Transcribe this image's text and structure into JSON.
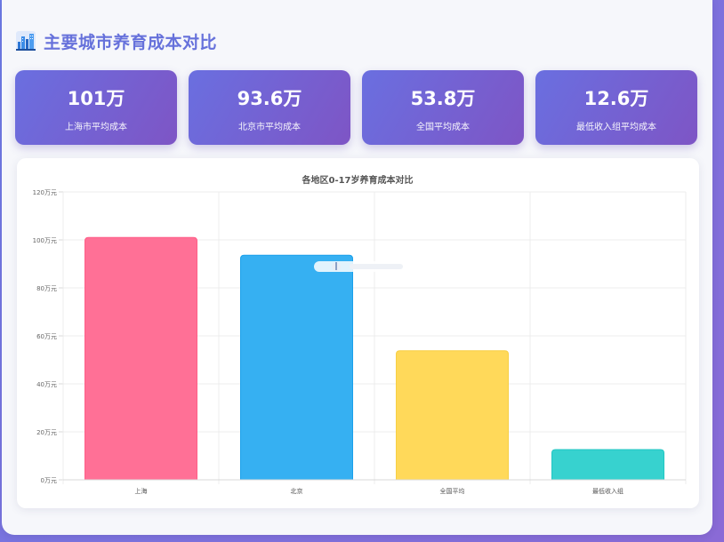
{
  "page": {
    "title": "主要城市养育成本对比",
    "icon": "city-chart-icon"
  },
  "stats": [
    {
      "value": "101万",
      "label": "上海市平均成本"
    },
    {
      "value": "93.6万",
      "label": "北京市平均成本"
    },
    {
      "value": "53.8万",
      "label": "全国平均成本"
    },
    {
      "value": "12.6万",
      "label": "最低收入组平均成本"
    }
  ],
  "colors": {
    "title": "#6671db",
    "card_gradient_start": "#6a6fe0",
    "card_gradient_end": "#7e55c5",
    "bars": [
      "#ff7096",
      "#36b0f2",
      "#ffd95a",
      "#37d2cf"
    ],
    "bar_borders": [
      "#ff5f88",
      "#1aa0eb",
      "#f7cf45",
      "#22c6c3"
    ]
  },
  "chart_data": {
    "type": "bar",
    "title": "各地区0-17岁养育成本对比",
    "categories": [
      "上海",
      "北京",
      "全国平均",
      "最低收入组"
    ],
    "values": [
      101,
      93.6,
      53.8,
      12.6
    ],
    "ylim": [
      0,
      120
    ],
    "yticks": [
      "0万元",
      "20万元",
      "40万元",
      "60万元",
      "80万元",
      "100万元",
      "120万元"
    ],
    "grid": true,
    "legend": "none"
  }
}
